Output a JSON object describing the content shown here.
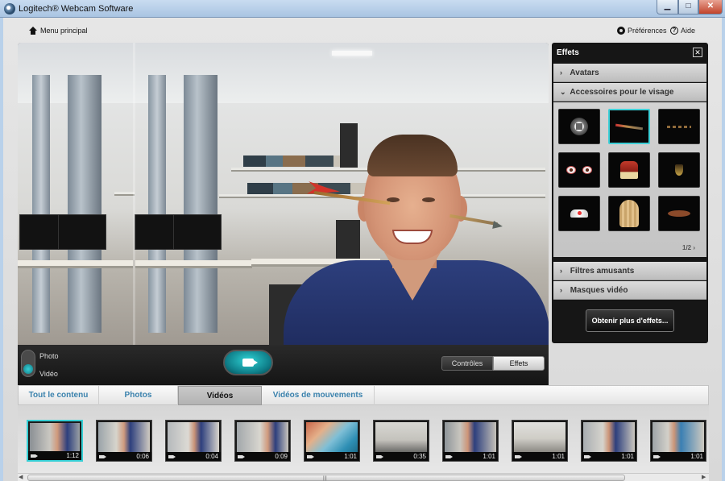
{
  "window": {
    "title": "Logitech® Webcam Software",
    "min_glyph": "▁",
    "max_glyph": "□",
    "close_glyph": "✕"
  },
  "nav": {
    "menu_label": "Menu principal",
    "preferences_label": "Préférences",
    "help_label": "Aide",
    "help_glyph": "?"
  },
  "capture": {
    "mode_photo": "Photo",
    "mode_video": "Vidéo",
    "selected_mode": "video",
    "controls_label": "Contrôles",
    "effects_label": "Effets"
  },
  "effects_panel": {
    "title": "Effets",
    "close_glyph": "✕",
    "sections": [
      {
        "label": "Avatars",
        "chevron": "›",
        "expanded": false
      },
      {
        "label": "Accessoires pour le visage",
        "chevron": "⌄",
        "expanded": true
      },
      {
        "label": "Filtres amusants",
        "chevron": "›",
        "expanded": false
      },
      {
        "label": "Masques vidéo",
        "chevron": "›",
        "expanded": false
      }
    ],
    "accessories": [
      {
        "name": "none",
        "icon": "stop-icon"
      },
      {
        "name": "arrow",
        "icon": "arrow-through-head-icon",
        "selected": true
      },
      {
        "name": "thin-arrow",
        "icon": "dotted-line-icon"
      },
      {
        "name": "eyes",
        "icon": "googly-eyes-icon"
      },
      {
        "name": "crown",
        "icon": "crown-icon"
      },
      {
        "name": "medal",
        "icon": "medal-icon"
      },
      {
        "name": "tiara",
        "icon": "tiara-icon"
      },
      {
        "name": "wig",
        "icon": "wig-icon"
      },
      {
        "name": "mustache",
        "icon": "mustache-icon"
      }
    ],
    "pager": "1/2",
    "pager_chevron": "›",
    "more_button": "Obtenir plus d'effets..."
  },
  "library": {
    "tabs": [
      {
        "label": "Tout le contenu",
        "active": false
      },
      {
        "label": "Photos",
        "active": false
      },
      {
        "label": "Vidéos",
        "active": true
      },
      {
        "label": "Vidéos de mouvements",
        "active": false
      }
    ],
    "thumbnails": [
      {
        "duration": "1:12",
        "selected": true,
        "scene": "person"
      },
      {
        "duration": "0:06",
        "selected": false,
        "scene": "person"
      },
      {
        "duration": "0:04",
        "selected": false,
        "scene": "person"
      },
      {
        "duration": "0:09",
        "selected": false,
        "scene": "person"
      },
      {
        "duration": "1:01",
        "selected": false,
        "scene": "landscape"
      },
      {
        "duration": "0:35",
        "selected": false,
        "scene": "office"
      },
      {
        "duration": "1:01",
        "selected": false,
        "scene": "person"
      },
      {
        "duration": "1:01",
        "selected": false,
        "scene": "office"
      },
      {
        "duration": "1:01",
        "selected": false,
        "scene": "person"
      },
      {
        "duration": "1:01",
        "selected": false,
        "scene": "person"
      }
    ],
    "scroll_left": "◀",
    "scroll_right": "▶",
    "scroll_grip": "|||"
  },
  "colors": {
    "accent": "#35cfd5",
    "tab_link": "#3b82ad",
    "panel_dark": "#161616"
  }
}
